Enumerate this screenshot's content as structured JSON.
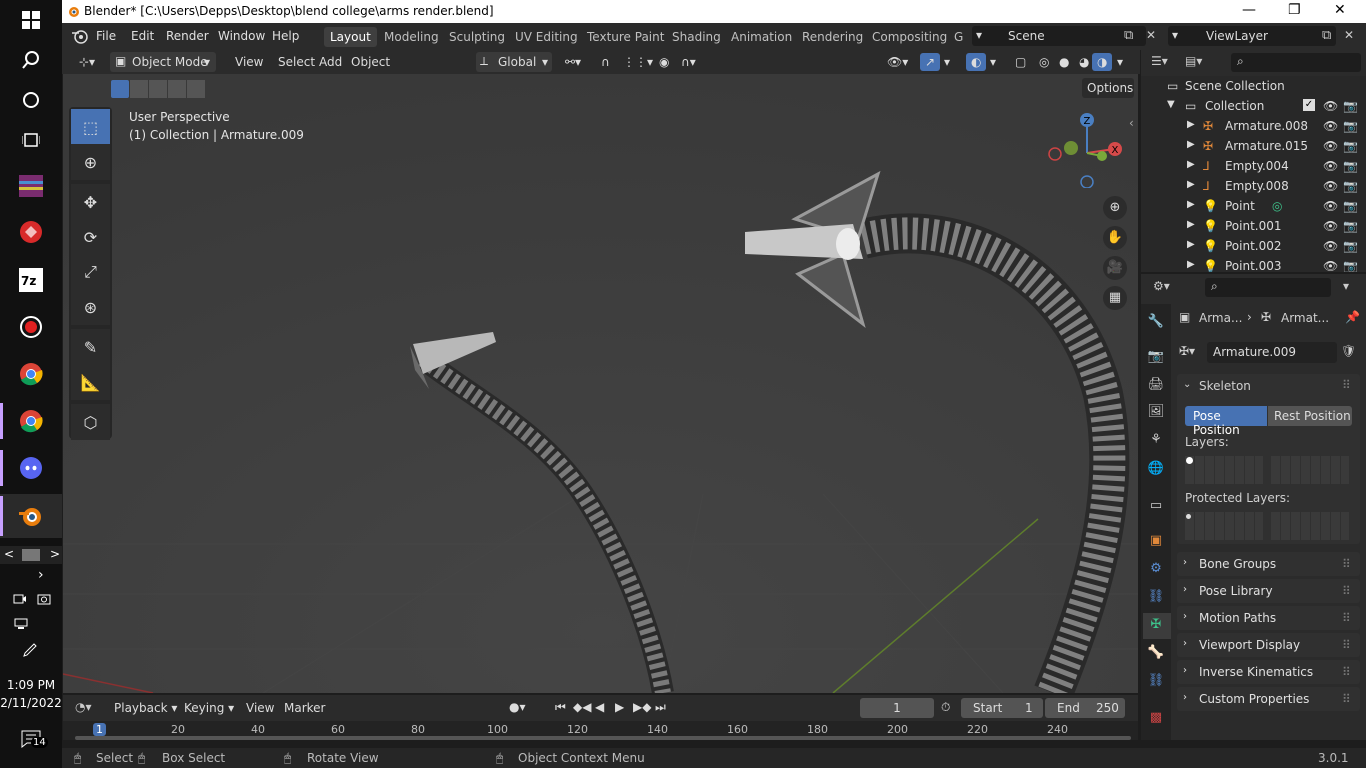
{
  "window": {
    "title": "Blender* [C:\\Users\\Depps\\Desktop\\blend college\\arms render.blend]"
  },
  "taskbar": {
    "time": "1:09 PM",
    "date": "2/11/2022",
    "notification_count": "14",
    "icons": [
      "windows-start-icon",
      "search-icon",
      "cortana-icon",
      "task-view-icon",
      "winrar-icon",
      "app-red-icon",
      "7zip-icon",
      "record-icon",
      "chrome-icon",
      "chrome-icon-2",
      "discord-icon",
      "blender-icon"
    ]
  },
  "menubar": {
    "items": [
      "File",
      "Edit",
      "Render",
      "Window",
      "Help"
    ],
    "workspaces": [
      "Layout",
      "Modeling",
      "Sculpting",
      "UV Editing",
      "Texture Paint",
      "Shading",
      "Animation",
      "Rendering",
      "Compositing",
      "G"
    ],
    "active_workspace": "Layout",
    "scene": "Scene",
    "view_layer": "ViewLayer"
  },
  "viewport_header": {
    "mode": "Object Mode",
    "menus": [
      "View",
      "Select",
      "Add",
      "Object"
    ],
    "transform_orientation": "Global",
    "options": "Options"
  },
  "viewport": {
    "view_name": "User Perspective",
    "context": "(1) Collection | Armature.009"
  },
  "outliner": {
    "root": "Scene Collection",
    "collection": "Collection",
    "items": [
      {
        "name": "Armature.008",
        "icon": "armature-icon"
      },
      {
        "name": "Armature.015",
        "icon": "armature-icon"
      },
      {
        "name": "Empty.004",
        "icon": "empty-icon"
      },
      {
        "name": "Empty.008",
        "icon": "empty-icon"
      },
      {
        "name": "Point",
        "icon": "light-icon"
      },
      {
        "name": "Point.001",
        "icon": "light-icon"
      },
      {
        "name": "Point.002",
        "icon": "light-icon"
      },
      {
        "name": "Point.003",
        "icon": "light-icon"
      }
    ]
  },
  "properties": {
    "breadcrumb_1": "Arma...",
    "breadcrumb_2": "Armat...",
    "data_name": "Armature.009",
    "skeleton_label": "Skeleton",
    "pose_position": "Pose Position",
    "rest_position": "Rest Position",
    "layers_label": "Layers:",
    "protected_layers_label": "Protected Layers:",
    "panels": [
      "Bone Groups",
      "Pose Library",
      "Motion Paths",
      "Viewport Display",
      "Inverse Kinematics",
      "Custom Properties"
    ]
  },
  "timeline": {
    "playback": "Playback",
    "keying": "Keying",
    "view": "View",
    "marker": "Marker",
    "current_frame": "1",
    "start_label": "Start",
    "start": "1",
    "end_label": "End",
    "end": "250",
    "ruler": [
      "1",
      "20",
      "40",
      "60",
      "80",
      "100",
      "120",
      "140",
      "160",
      "180",
      "200",
      "220",
      "240"
    ]
  },
  "statusbar": {
    "select": "Select",
    "box_select": "Box Select",
    "rotate_view": "Rotate View",
    "context_menu": "Object Context Menu",
    "version": "3.0.1"
  }
}
